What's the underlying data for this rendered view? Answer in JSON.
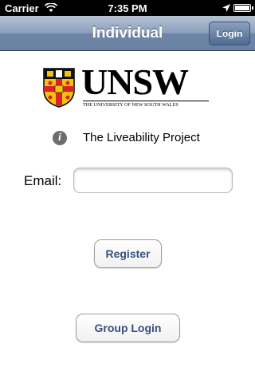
{
  "status_bar": {
    "carrier": "Carrier",
    "time": "7:35 PM"
  },
  "nav": {
    "title": "Individual",
    "login_button": "Login"
  },
  "logo": {
    "wordmark": "UNSW",
    "subtitle": "THE UNIVERSITY OF NEW SOUTH WALES"
  },
  "info": {
    "icon": "info-icon",
    "text": "The Liveability Project"
  },
  "form": {
    "email_label": "Email:",
    "email_value": "",
    "email_placeholder": ""
  },
  "buttons": {
    "register": "Register",
    "group_login": "Group Login"
  },
  "colors": {
    "nav_bar": "#6d85a6",
    "button_text": "#394f7e",
    "crest_red": "#d8232a",
    "crest_gold": "#f4c20d"
  }
}
